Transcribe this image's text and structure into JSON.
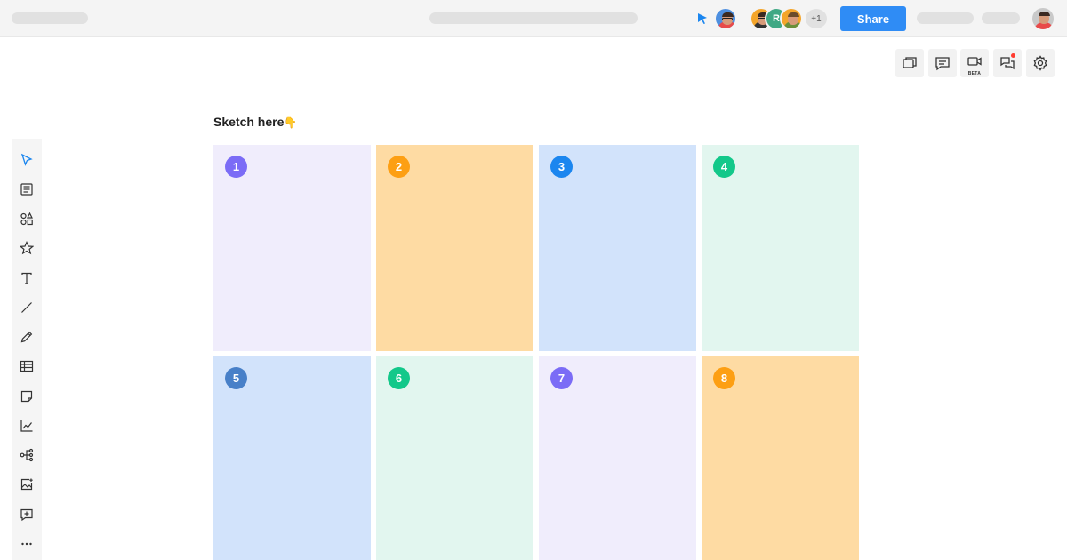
{
  "header": {
    "share_label": "Share",
    "collaborator_initial": "R",
    "extra_collaborators": "+1"
  },
  "toolbar_right": {
    "video_badge": "BETA"
  },
  "board": {
    "title": "Sketch here",
    "title_emoji": "👇",
    "cards": [
      {
        "number": "1",
        "bg": "#f0edfc",
        "badge": "#7b6cf6"
      },
      {
        "number": "2",
        "bg": "#fedba3",
        "badge": "#fd9f13"
      },
      {
        "number": "3",
        "bg": "#d2e3fb",
        "badge": "#1b86ef"
      },
      {
        "number": "4",
        "bg": "#e2f6ef",
        "badge": "#13c88a"
      },
      {
        "number": "5",
        "bg": "#d2e3fb",
        "badge": "#4880c8"
      },
      {
        "number": "6",
        "bg": "#e2f6ef",
        "badge": "#13c88a"
      },
      {
        "number": "7",
        "bg": "#f0edfc",
        "badge": "#7b6cf6"
      },
      {
        "number": "8",
        "bg": "#fedba3",
        "badge": "#fd9f13"
      }
    ]
  },
  "colors": {
    "accent": "#2f8cf5",
    "cursor": "#1b86ef"
  }
}
